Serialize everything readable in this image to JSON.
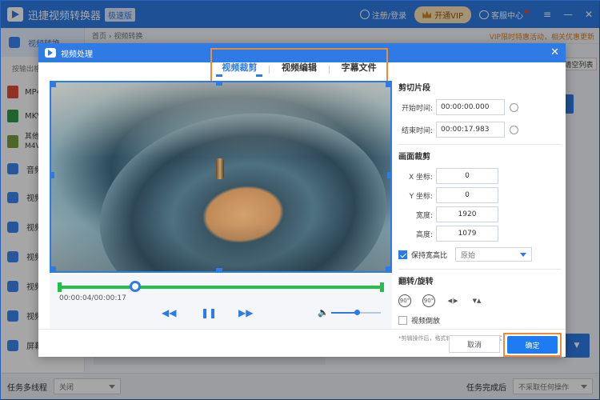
{
  "app": {
    "title": "迅捷视频转换器",
    "edition": "极速版",
    "login": "注册/登录",
    "vip": "开通VIP",
    "service": "客服中心",
    "win_controls": [
      "≡",
      "—",
      "✕"
    ]
  },
  "sidebar": {
    "active": "视频转换",
    "sub_label": "按输出格",
    "formats": [
      {
        "label": "MP4",
        "color": "#e24a3b"
      },
      {
        "label": "MKV",
        "color": "#2f9a4a"
      },
      {
        "label": "其他格\nM4V、",
        "color": "#7a9e3b"
      }
    ],
    "sections": [
      "音频",
      "视频",
      "视频",
      "视频",
      "视频",
      "视频",
      "屏幕"
    ]
  },
  "breadcrumb": "首页 › 视频转换",
  "banner": "VIP限时特惠活动，相关优惠更新",
  "bg_clear_list": "清空列表",
  "statusbar": {
    "multithread_label": "任务多线程",
    "multithread_value": "关闭",
    "complete_label": "任务完成后",
    "complete_value": "不采取任何操作"
  },
  "modal": {
    "title": "视频处理",
    "close": "✕",
    "tabs": [
      "视频裁剪",
      "视频编辑",
      "字幕文件"
    ],
    "active_tab": 0,
    "player": {
      "timecode": "00:00:04/00:00:17",
      "prev": "◀◀",
      "pause": "❚❚",
      "next": "▶▶",
      "volume_icon": "🔈",
      "progress": 0.2353,
      "volume": 0.52
    },
    "clip": {
      "title": "剪切片段",
      "start_label": "开始时间:",
      "start_value": "00:00:00.000",
      "end_label": "结束时间:",
      "end_value": "00:00:17.983"
    },
    "crop": {
      "title": "画面裁剪",
      "x_label": "X 坐标:",
      "x_value": "0",
      "y_label": "Y 坐标:",
      "y_value": "0",
      "w_label": "宽度:",
      "w_value": "1920",
      "h_label": "高度:",
      "h_value": "1079",
      "keep_ratio_label": "保持宽高比",
      "keep_ratio_checked": true,
      "ratio_value": "原始"
    },
    "rotate": {
      "title": "翻转/旋转",
      "icons": [
        "rotate-left-icon",
        "rotate-right-icon",
        "flip-horizontal-icon",
        "flip-vertical-icon"
      ],
      "reverse_label": "视频倒放",
      "note": "*剪辑操作后，格式转换将不支持闪电模式"
    },
    "buttons": {
      "cancel": "取消",
      "ok": "确定"
    }
  },
  "colors": {
    "primary": "#2e7be6",
    "highlight": "#f08a35",
    "progress": "#22c04a"
  }
}
